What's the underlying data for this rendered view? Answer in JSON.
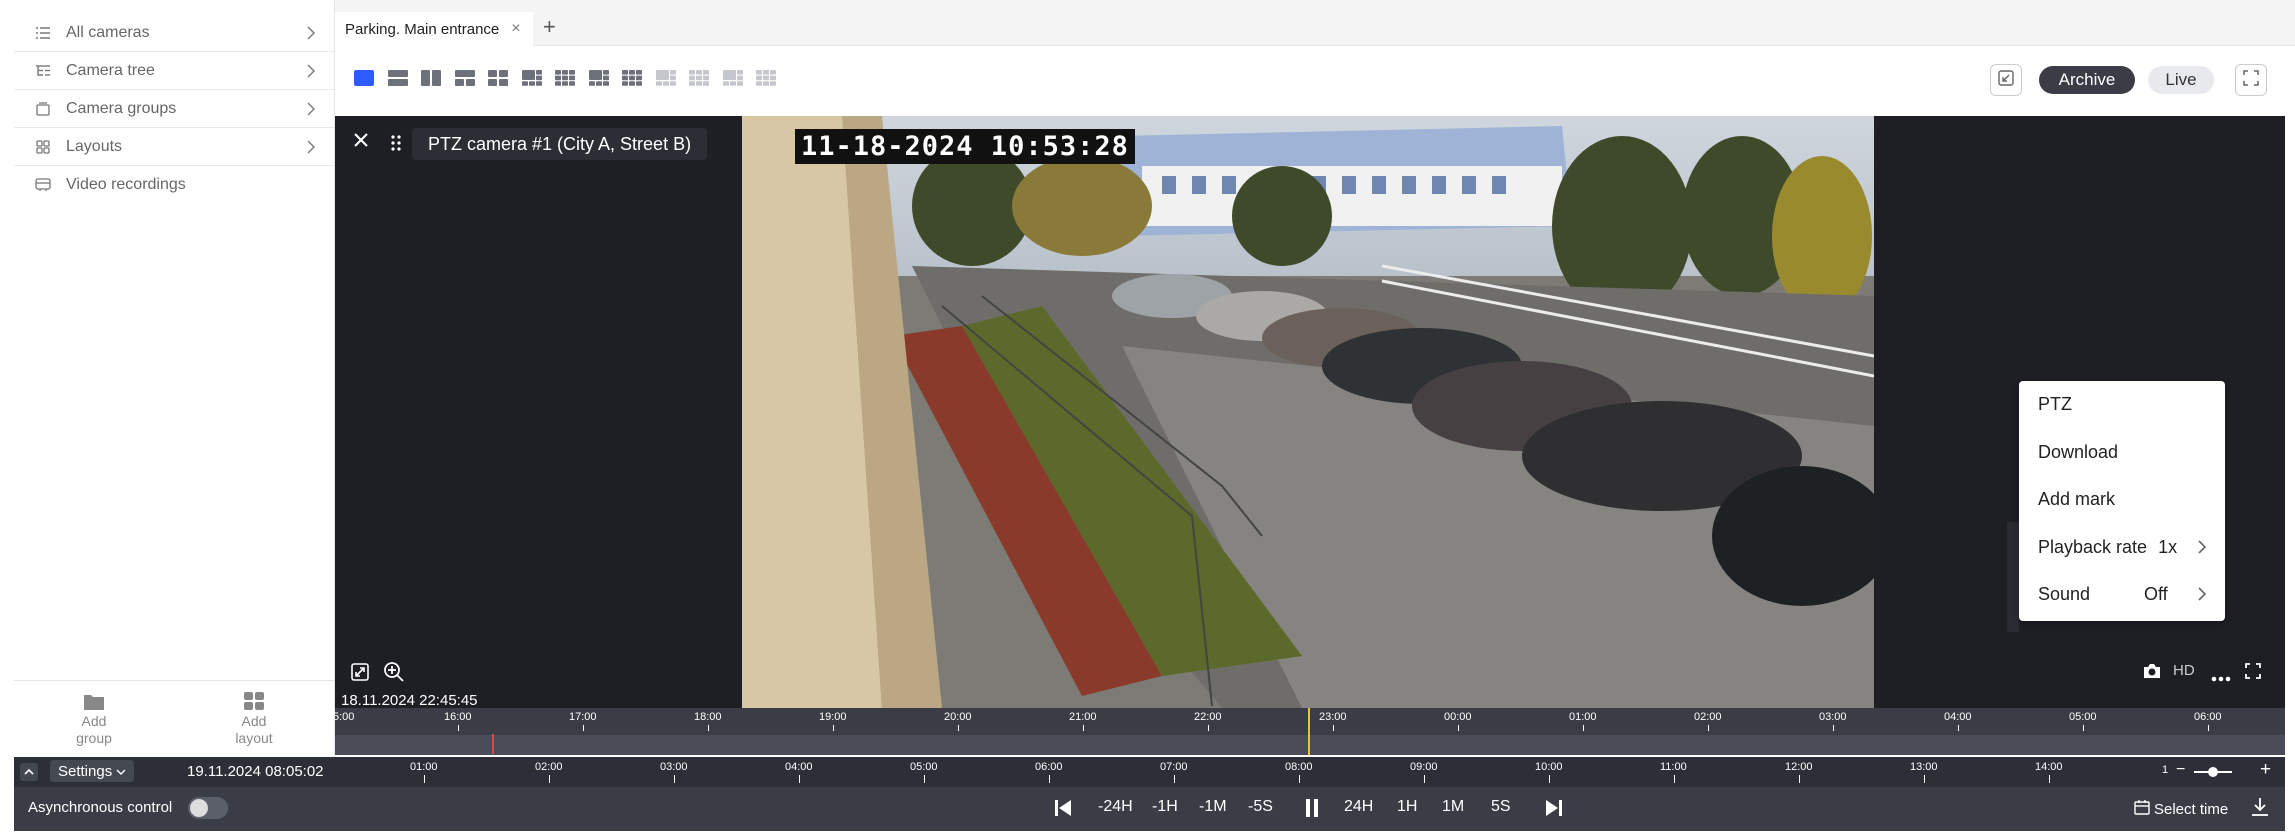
{
  "sidebar": {
    "items": [
      {
        "label": "All cameras",
        "icon": "list-icon",
        "has_arrow": true
      },
      {
        "label": "Camera tree",
        "icon": "tree-icon",
        "has_arrow": true
      },
      {
        "label": "Camera groups",
        "icon": "folder-icon",
        "has_arrow": true
      },
      {
        "label": "Layouts",
        "icon": "grid-icon",
        "has_arrow": true
      },
      {
        "label": "Video recordings",
        "icon": "video-icon",
        "has_arrow": false
      }
    ],
    "add_group": "Add\ngroup",
    "add_group_l1": "Add",
    "add_group_l2": "group",
    "add_layout_l1": "Add",
    "add_layout_l2": "layout"
  },
  "tabs": {
    "active": "Parking. Main entrance",
    "close": "×",
    "add": "+"
  },
  "toolbar": {
    "archive": "Archive",
    "live": "Live",
    "mode": "archive",
    "accent": "#2d5bff"
  },
  "viewer": {
    "camera_title": "PTZ camera #1 (City A, Street B)",
    "osd_timestamp": "11-18-2024 10:53:28",
    "hd": "HD"
  },
  "context_menu": {
    "ptz": "PTZ",
    "download": "Download",
    "add_mark": "Add mark",
    "playback_rate_label": "Playback rate",
    "playback_rate_value": "1x",
    "sound_label": "Sound",
    "sound_value": "Off"
  },
  "timeline": {
    "start_datetime": "18.11.2024 22:45:45",
    "current_datetime": "19.11.2024 08:05:02",
    "top_ticks": [
      "5:00",
      "16:00",
      "17:00",
      "18:00",
      "19:00",
      "20:00",
      "21:00",
      "22:00",
      "23:00",
      "00:00",
      "01:00",
      "02:00",
      "03:00",
      "04:00",
      "05:00",
      "06:00"
    ],
    "bottom_ticks": [
      "01:00",
      "02:00",
      "03:00",
      "04:00",
      "05:00",
      "06:00",
      "07:00",
      "08:00",
      "09:00",
      "10:00",
      "11:00",
      "12:00",
      "13:00",
      "14:00"
    ],
    "zoom_value": "1",
    "cursor_color": "#e8c62e",
    "mark_color": "#e04444"
  },
  "controls": {
    "settings": "Settings",
    "async": "Asynchronous control",
    "async_on": false,
    "back_24h": "-24H",
    "back_1h": "-1H",
    "back_1m": "-1M",
    "back_5s": "-5S",
    "fwd_24h": "24H",
    "fwd_1h": "1H",
    "fwd_1m": "1M",
    "fwd_5s": "5S",
    "select_time": "Select time"
  }
}
